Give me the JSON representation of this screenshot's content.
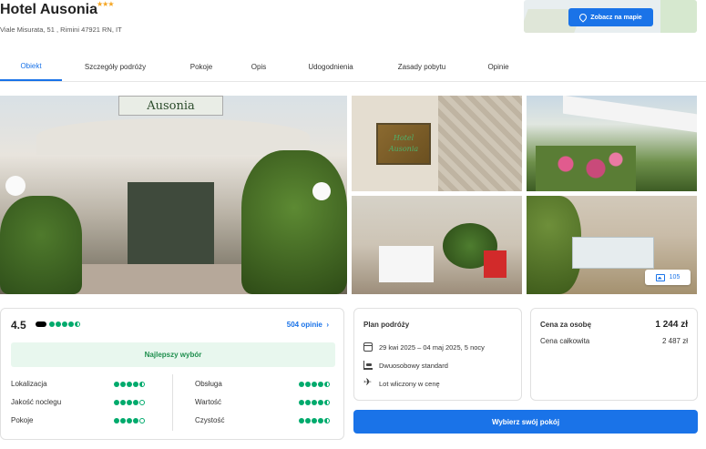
{
  "header": {
    "hotel_name": "Hotel Ausonia",
    "stars": "★★★",
    "address": "Viale Misurata, 51 , Rimini 47921 RN, IT",
    "map_button": "Zobacz na mapie"
  },
  "tabs": [
    {
      "label": "Obiekt",
      "active": true
    },
    {
      "label": "Szczegóły podróży"
    },
    {
      "label": "Pokoje"
    },
    {
      "label": "Opis"
    },
    {
      "label": "Udogodnienia"
    },
    {
      "label": "Zasady pobytu"
    },
    {
      "label": "Opinie"
    }
  ],
  "gallery": {
    "main_sign": "Ausonia",
    "plaque_line1": "Hotel",
    "plaque_line2": "Ausonia",
    "photo_count": "105"
  },
  "rating": {
    "score": "4.5",
    "reviews_link": "504 opinie",
    "best_choice": "Najlepszy wybór",
    "criteria_left": [
      {
        "label": "Lokalizacja",
        "dots": 4.5
      },
      {
        "label": "Jakość noclegu",
        "dots": 4
      },
      {
        "label": "Pokoje",
        "dots": 4
      }
    ],
    "criteria_right": [
      {
        "label": "Obsługa",
        "dots": 4.5
      },
      {
        "label": "Wartość",
        "dots": 4.5
      },
      {
        "label": "Czystość",
        "dots": 4.5
      }
    ],
    "overall_dots": 4.5
  },
  "plan": {
    "title": "Plan podróży",
    "dates": "29 kwi 2025 – 04 maj 2025, 5 nocy",
    "room": "Dwuosobowy standard",
    "flight": "Lot wliczony w cenę"
  },
  "price": {
    "per_person_label": "Cena za osobę",
    "per_person_value": "1 244 zł",
    "total_label": "Cena całkowita",
    "total_value": "2 487 zł"
  },
  "cta": {
    "select_button": "Wybierz swój pokój"
  },
  "colors": {
    "accent": "#1a73e8",
    "rating_green": "#00aa6c",
    "best_choice_bg": "#e8f7ee"
  }
}
